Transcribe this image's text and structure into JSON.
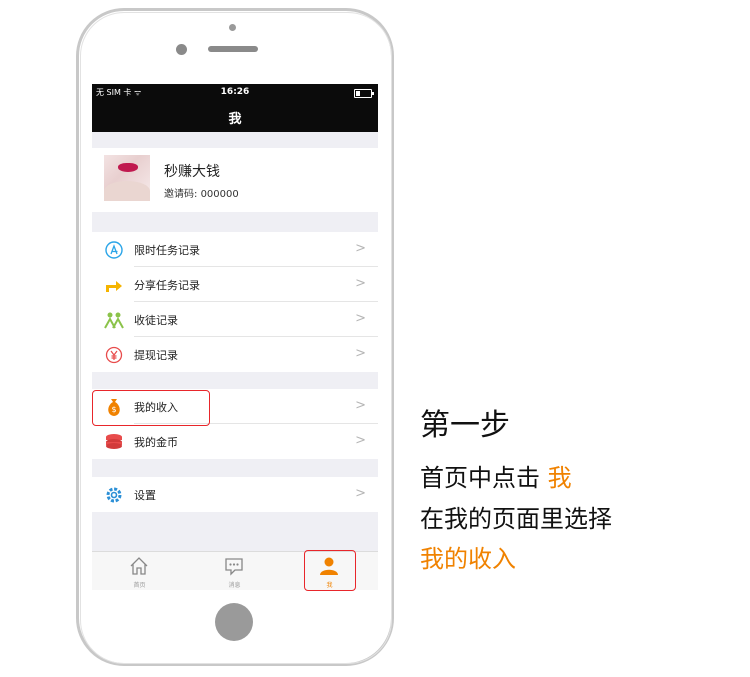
{
  "status_bar": {
    "carrier": "无 SIM 卡 ᯤ",
    "time": "16:26"
  },
  "nav": {
    "title": "我"
  },
  "profile": {
    "name": "秒赚大钱",
    "invite_label": "邀请码:",
    "invite_code": "000000"
  },
  "menu_group_1": [
    {
      "label": "限时任务记录",
      "icon": "app-store-icon",
      "color": "#2ba5e8"
    },
    {
      "label": "分享任务记录",
      "icon": "share-arrow-icon",
      "color": "#f5b400"
    },
    {
      "label": "收徒记录",
      "icon": "people-icon",
      "color": "#8bc34a"
    },
    {
      "label": "提现记录",
      "icon": "yuan-icon",
      "color": "#e84b4b"
    }
  ],
  "menu_group_2": [
    {
      "label": "我的收入",
      "icon": "money-bag-icon",
      "color": "#f08200"
    },
    {
      "label": "我的金币",
      "icon": "coins-icon",
      "color": "#e84b4b"
    }
  ],
  "menu_group_3": [
    {
      "label": "设置",
      "icon": "gear-icon",
      "color": "#2b8fd6"
    }
  ],
  "chevron": ">",
  "tabbar": [
    {
      "label": "首页",
      "icon": "home-icon"
    },
    {
      "label": "消息",
      "icon": "message-icon"
    },
    {
      "label": "我",
      "icon": "person-icon",
      "active": true
    }
  ],
  "instructions": {
    "title": "第一步",
    "line1_prefix": "首页中点击 ",
    "line1_highlight": "我",
    "line2": "在我的页面里选择",
    "line3": "我的收入"
  },
  "colors": {
    "accent": "#f08200",
    "highlight_box": "#e8262b",
    "navbar": "#0b0b0b"
  }
}
